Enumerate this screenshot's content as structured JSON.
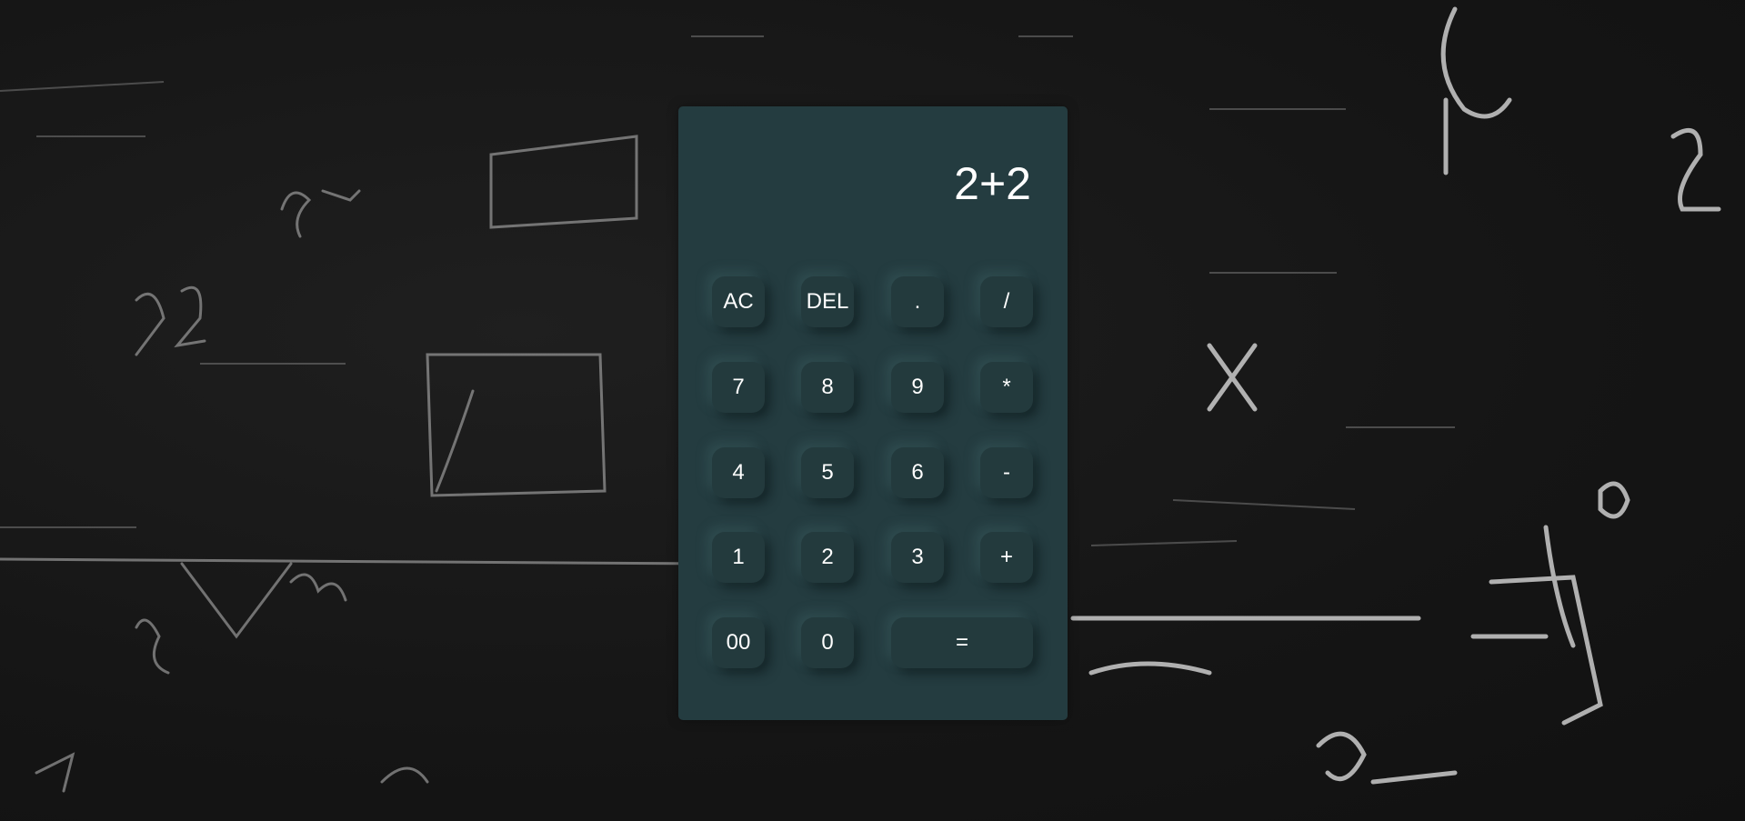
{
  "display": {
    "expression": "2+2"
  },
  "keys": {
    "ac": "AC",
    "del": "DEL",
    "dot": ".",
    "divide": "/",
    "seven": "7",
    "eight": "8",
    "nine": "9",
    "multiply": "*",
    "four": "4",
    "five": "5",
    "six": "6",
    "minus": "-",
    "one": "1",
    "two": "2",
    "three": "3",
    "plus": "+",
    "double_zero": "00",
    "zero": "0",
    "equals": "="
  },
  "colors": {
    "calculator_bg": "#243c40",
    "key_bg": "#233a3d",
    "text": "#ffffff",
    "background": "#161616"
  }
}
